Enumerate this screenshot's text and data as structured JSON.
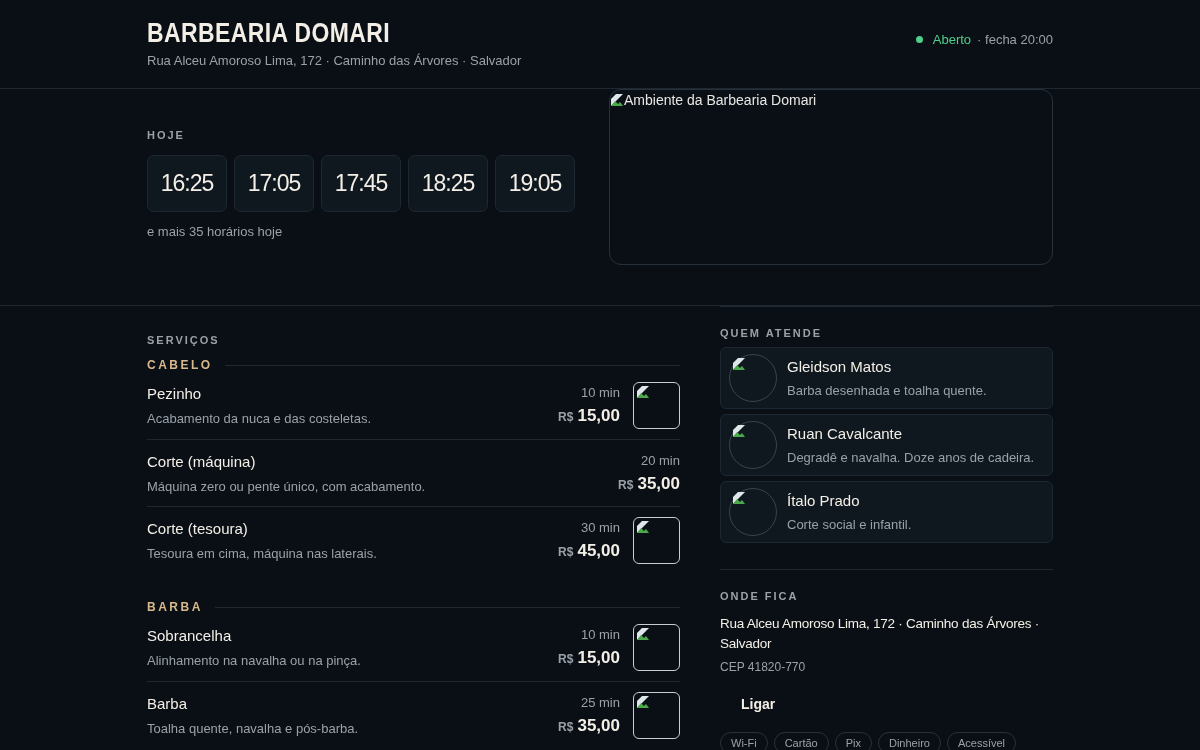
{
  "header": {
    "title": "BARBEARIA DOMARI",
    "address": "Rua Alceu Amoroso Lima, 172 · Caminho das Árvores · Salvador",
    "status": {
      "open": true,
      "label": "Aberto",
      "closes": "· fecha 20:00"
    }
  },
  "today": {
    "label": "HOJE",
    "slots": [
      "16:25",
      "17:05",
      "17:45",
      "18:25",
      "19:05"
    ],
    "more": "e mais 35 horários hoje"
  },
  "photo": {
    "kind": "picture",
    "alt": "Ambiente da Barbearia Domari"
  },
  "services": {
    "label": "SERVIÇOS",
    "groups": [
      {
        "name": "CABELO",
        "items": [
          {
            "name": "Pezinho",
            "description": "Acabamento da nuca e das costeletas.",
            "duration": "10 min",
            "currency": "R$",
            "price": "15,00",
            "thumb": true
          },
          {
            "name": "Corte (máquina)",
            "description": "Máquina zero ou pente único, com acabamento.",
            "duration": "20 min",
            "currency": "R$",
            "price": "35,00",
            "thumb": false
          },
          {
            "name": "Corte (tesoura)",
            "description": "Tesoura em cima, máquina nas laterais.",
            "duration": "30 min",
            "currency": "R$",
            "price": "45,00",
            "thumb": true
          }
        ]
      },
      {
        "name": "BARBA",
        "items": [
          {
            "name": "Sobrancelha",
            "description": "Alinhamento na navalha ou na pinça.",
            "duration": "10 min",
            "currency": "R$",
            "price": "15,00",
            "thumb": true
          },
          {
            "name": "Barba",
            "description": "Toalha quente, navalha e pós-barba.",
            "duration": "25 min",
            "currency": "R$",
            "price": "35,00",
            "thumb": true
          }
        ]
      }
    ]
  },
  "staff": {
    "label": "QUEM ATENDE",
    "people": [
      {
        "name": "Gleidson Matos",
        "bio": "Barba desenhada e toalha quente."
      },
      {
        "name": "Ruan Cavalcante",
        "bio": "Degradê e navalha. Doze anos de cadeira."
      },
      {
        "name": "Ítalo Prado",
        "bio": "Corte social e infantil."
      }
    ]
  },
  "location": {
    "label": "ONDE FICA",
    "address": "Rua Alceu Amoroso Lima, 172 · Caminho das Árvores · Salvador",
    "cep": "CEP 41820-770",
    "call": "Ligar",
    "tags": [
      "Wi-Fi",
      "Cartão",
      "Pix",
      "Dinheiro",
      "Acessível"
    ]
  }
}
